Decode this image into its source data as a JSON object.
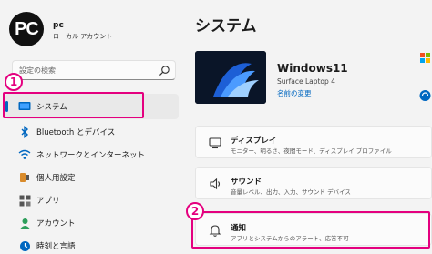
{
  "user": {
    "avatar_initials": "PC",
    "name": "pc",
    "account_type": "ローカル アカウント"
  },
  "search": {
    "placeholder": "設定の検索"
  },
  "nav": {
    "items": [
      {
        "label": "システム",
        "icon": "system-icon",
        "active": true
      },
      {
        "label": "Bluetooth とデバイス",
        "icon": "bluetooth-icon"
      },
      {
        "label": "ネットワークとインターネット",
        "icon": "network-icon"
      },
      {
        "label": "個人用設定",
        "icon": "personalization-icon"
      },
      {
        "label": "アプリ",
        "icon": "apps-icon"
      },
      {
        "label": "アカウント",
        "icon": "account-icon"
      },
      {
        "label": "時刻と言語",
        "icon": "time-language-icon"
      }
    ]
  },
  "page": {
    "title": "システム"
  },
  "device": {
    "name": "Windows11",
    "model": "Surface Laptop 4",
    "rename_label": "名前の変更"
  },
  "cards": [
    {
      "title": "ディスプレイ",
      "subtitle": "モニター、明るさ、夜間モード、ディスプレイ プロファイル",
      "icon": "display-icon"
    },
    {
      "title": "サウンド",
      "subtitle": "音量レベル、出力、入力、サウンド デバイス",
      "icon": "sound-icon"
    },
    {
      "title": "通知",
      "subtitle": "アプリとシステムからのアラート、応答不可",
      "icon": "notification-bell-icon"
    }
  ],
  "annotations": {
    "badge_1": "1",
    "badge_2": "2",
    "highlight_color": "#e4007f"
  },
  "colors": {
    "accent": "#0067c0",
    "background": "#f3f3f3"
  }
}
